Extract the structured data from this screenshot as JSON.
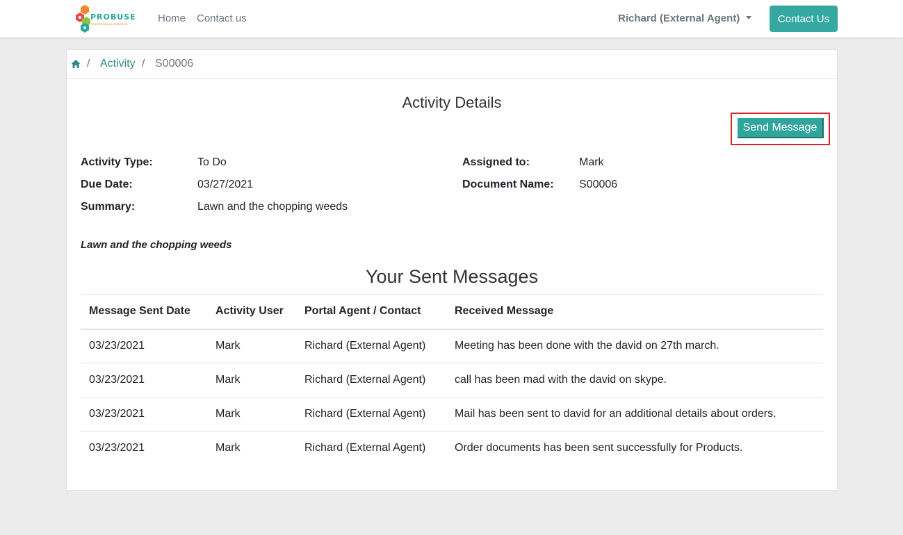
{
  "colors": {
    "accent": "#35a9a1",
    "breadcrumb_link": "#2a8a84",
    "highlight_border": "#d9262b",
    "background": "#ececec"
  },
  "navbar": {
    "logo_text": "PROBUSE",
    "logo_subtext": "PROFESSIONAL BUSINESS",
    "links": [
      "Home",
      "Contact us"
    ],
    "user_menu_label": "Richard (External Agent)",
    "contact_button_label": "Contact Us"
  },
  "breadcrumb": {
    "home_icon": "home-icon",
    "separator": "/",
    "activity": "Activity",
    "current": "S00006"
  },
  "details": {
    "title": "Activity Details",
    "send_message_label": "Send Message",
    "fields_left": [
      {
        "label": "Activity Type:",
        "value": "To Do"
      },
      {
        "label": "Due Date:",
        "value": "03/27/2021"
      },
      {
        "label": "Summary:",
        "value": "Lawn and the chopping weeds"
      }
    ],
    "fields_right": [
      {
        "label": "Assigned to:",
        "value": "Mark"
      },
      {
        "label": "Document Name:",
        "value": "S00006"
      }
    ],
    "note": "Lawn and the chopping weeds"
  },
  "messages": {
    "title": "Your Sent Messages",
    "columns": [
      "Message Sent Date",
      "Activity User",
      "Portal Agent / Contact",
      "Received Message"
    ],
    "rows": [
      [
        "03/23/2021",
        "Mark",
        "Richard (External Agent)",
        "Meeting has been done with the david on 27th march."
      ],
      [
        "03/23/2021",
        "Mark",
        "Richard (External Agent)",
        "call has been mad with the david on skype."
      ],
      [
        "03/23/2021",
        "Mark",
        "Richard (External Agent)",
        "Mail has been sent to david for an additional details about orders."
      ],
      [
        "03/23/2021",
        "Mark",
        "Richard (External Agent)",
        "Order documents has been sent successfully for Products."
      ]
    ]
  }
}
